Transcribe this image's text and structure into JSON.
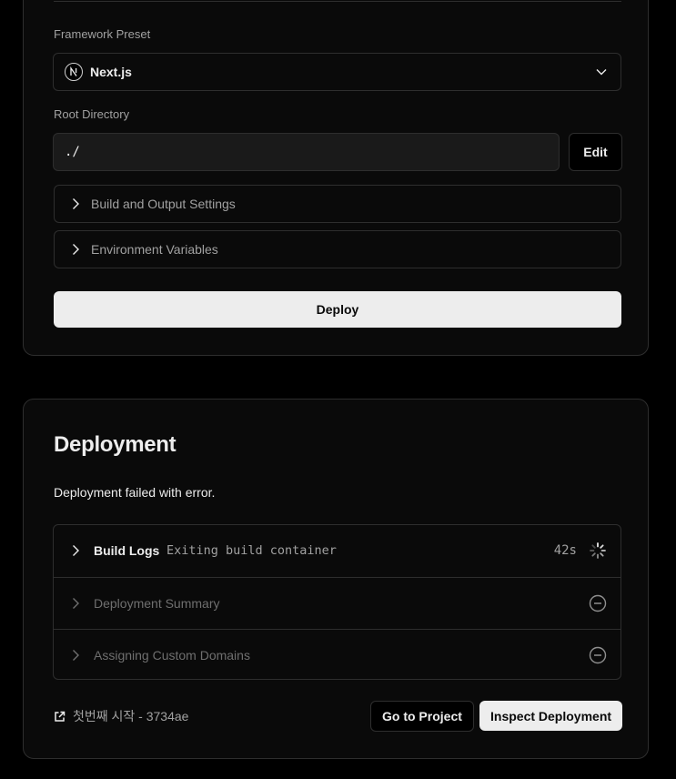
{
  "config": {
    "framework_label": "Framework Preset",
    "framework_value": "Next.js",
    "framework_icon": "nextjs-logo-icon",
    "root_label": "Root Directory",
    "root_value": "./",
    "edit_label": "Edit",
    "sections": [
      {
        "label": "Build and Output Settings",
        "icon": "chevron-right-icon"
      },
      {
        "label": "Environment Variables",
        "icon": "chevron-right-icon"
      }
    ],
    "deploy_label": "Deploy"
  },
  "deployment": {
    "title": "Deployment",
    "status": "Deployment failed with error.",
    "steps": [
      {
        "label": "Build Logs",
        "detail": "Exiting build container",
        "duration": "42s",
        "state": "spinner-icon"
      },
      {
        "label": "Deployment Summary",
        "state": "minus-circle-icon"
      },
      {
        "label": "Assigning Custom Domains",
        "state": "minus-circle-icon"
      }
    ],
    "commit": "첫번째 시작 - 3734ae",
    "go_to_project": "Go to Project",
    "inspect": "Inspect Deployment"
  },
  "colors": {
    "background": "#000000",
    "card": "#0a0a0a",
    "border": "#2e2e2e",
    "text": "#ededed",
    "muted": "#a1a1a1",
    "primary_button": "#ededed"
  }
}
